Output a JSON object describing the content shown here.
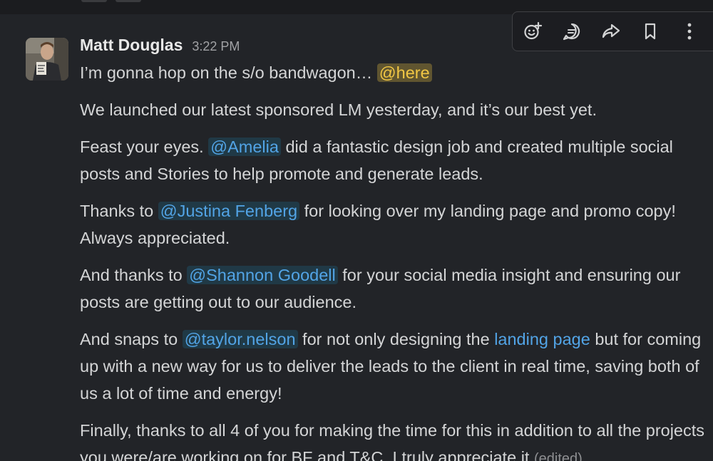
{
  "message": {
    "author": "Matt Douglas",
    "timestamp": "3:22 PM",
    "paragraphs": {
      "p1": {
        "text": "I’m gonna hop on the s/o bandwagon… ",
        "mention": "@here"
      },
      "p2": {
        "text": "We launched our latest sponsored LM yesterday, and it’s our best yet."
      },
      "p3": {
        "pre": "Feast your eyes. ",
        "mention": "@Amelia",
        "post": " did a fantastic design job and created multiple social posts and Stories to help promote and generate leads."
      },
      "p4": {
        "pre": "Thanks to ",
        "mention": "@Justina Fenberg",
        "post": " for looking over my landing page and promo copy! Always appreciated."
      },
      "p5": {
        "pre": "And thanks to ",
        "mention": "@Shannon Goodell",
        "post": " for your social media insight and ensuring our posts are getting out to our audience."
      },
      "p6": {
        "pre": "And snaps to ",
        "mention": "@taylor.nelson",
        "mid": " for not only designing the ",
        "link": "landing page",
        "post": " but for coming up with a new way for us to deliver the leads to the client in real time, saving both of us a lot of time and energy!"
      },
      "p7": {
        "text": "Finally, thanks to all 4 of you for making the time for this in addition to all the projects you were/are working on for BF and T&C. I truly appreciate it ",
        "edited": "(edited)"
      }
    }
  },
  "actions": [
    "add-reaction-icon",
    "reply-in-thread-icon",
    "share-icon",
    "bookmark-icon",
    "more-actions-icon"
  ],
  "colors": {
    "background": "#222428",
    "mention": "#52a4e6",
    "mention_here": "#f2c744",
    "text": "#d4d5d6"
  }
}
